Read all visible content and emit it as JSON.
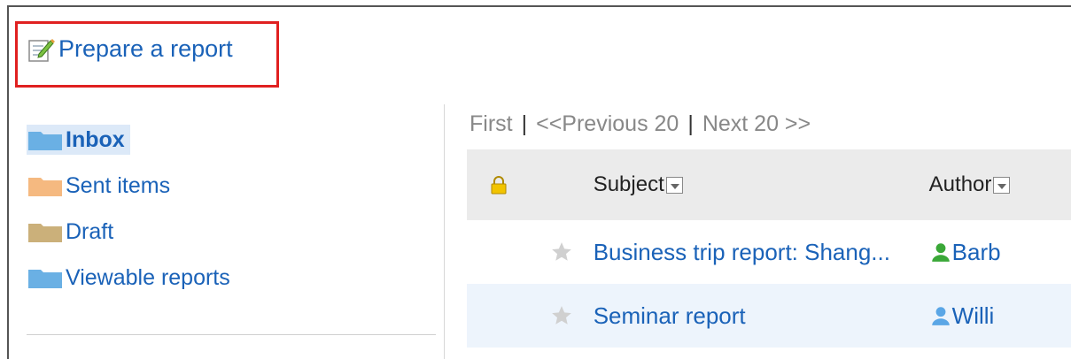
{
  "toolbar": {
    "prepare_label": "Prepare a report"
  },
  "folders": [
    {
      "label": "Inbox",
      "color": "#6ab0e4",
      "active": true
    },
    {
      "label": "Sent items",
      "color": "#f5b980",
      "active": false
    },
    {
      "label": "Draft",
      "color": "#cbb07a",
      "active": false
    },
    {
      "label": "Viewable reports",
      "color": "#6ab0e4",
      "active": false
    }
  ],
  "pager": {
    "first": "First",
    "prev": "<<Previous 20",
    "next": "Next 20 >>",
    "separator": "|"
  },
  "table": {
    "headers": {
      "subject": "Subject",
      "author": "Author"
    },
    "rows": [
      {
        "subject": "Business trip report: Shang...",
        "author": "Barb",
        "author_icon_color": "#3aa838"
      },
      {
        "subject": "Seminar report",
        "author": "Willi",
        "author_icon_color": "#5aa6e6"
      }
    ]
  }
}
